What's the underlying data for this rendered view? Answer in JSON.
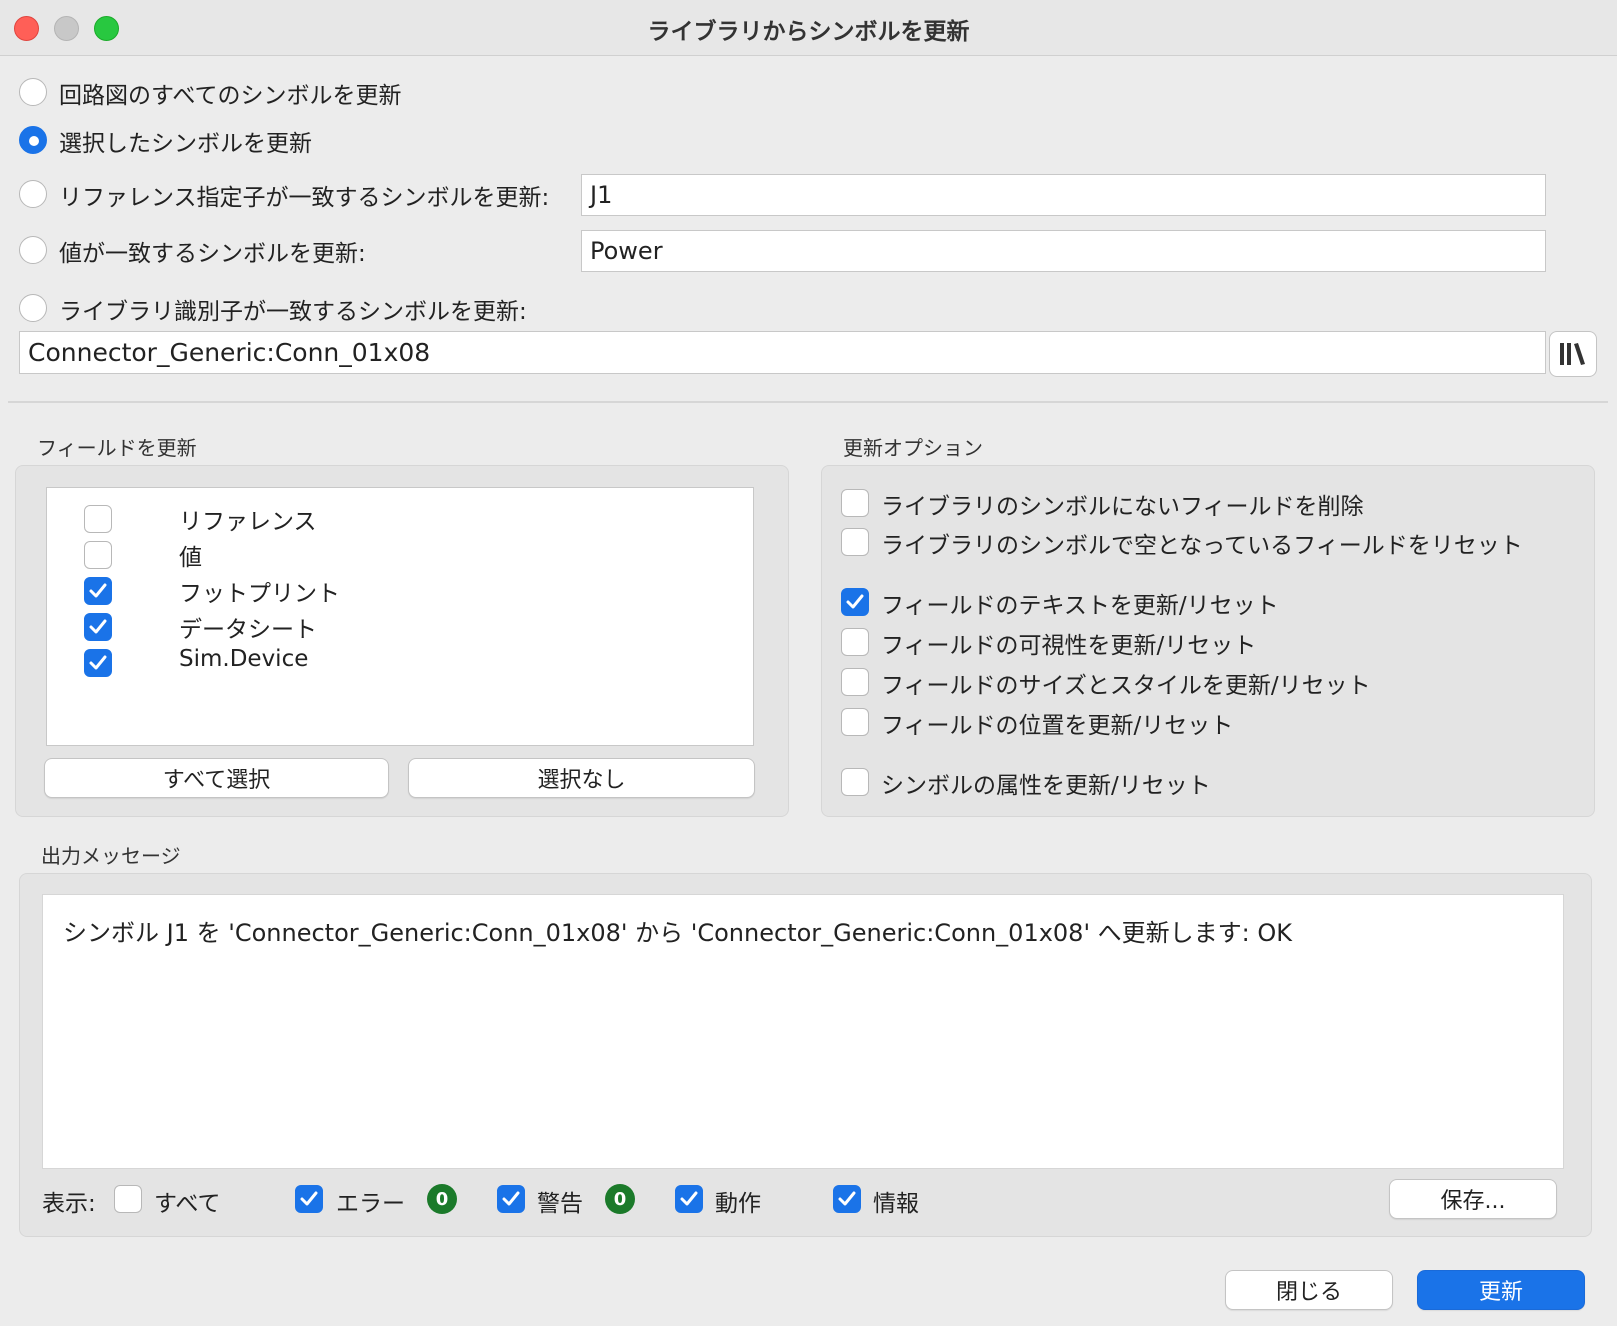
{
  "window": {
    "title": "ライブラリからシンボルを更新"
  },
  "scope": {
    "options": [
      {
        "label": "回路図のすべてのシンボルを更新",
        "selected": false
      },
      {
        "label": "選択したシンボルを更新",
        "selected": true
      },
      {
        "label": "リファレンス指定子が一致するシンボルを更新:",
        "selected": false
      },
      {
        "label": "値が一致するシンボルを更新:",
        "selected": false
      },
      {
        "label": "ライブラリ識別子が一致するシンボルを更新:",
        "selected": false
      }
    ],
    "reference_value": "J1",
    "value_value": "Power",
    "lib_id_value": "Connector_Generic:Conn_01x08"
  },
  "fields_group": {
    "title": "フィールドを更新",
    "items": [
      {
        "label": "リファレンス",
        "checked": false
      },
      {
        "label": "値",
        "checked": false
      },
      {
        "label": "フットプリント",
        "checked": true
      },
      {
        "label": "データシート",
        "checked": true
      },
      {
        "label": "Sim.Device",
        "checked": true
      }
    ],
    "select_all_label": "すべて選択",
    "select_none_label": "選択なし"
  },
  "update_options": {
    "title": "更新オプション",
    "items": [
      {
        "label": "ライブラリのシンボルにないフィールドを削除",
        "checked": false
      },
      {
        "label": "ライブラリのシンボルで空となっているフィールドをリセット",
        "checked": false
      },
      {
        "label": "フィールドのテキストを更新/リセット",
        "checked": true
      },
      {
        "label": "フィールドの可視性を更新/リセット",
        "checked": false
      },
      {
        "label": "フィールドのサイズとスタイルを更新/リセット",
        "checked": false
      },
      {
        "label": "フィールドの位置を更新/リセット",
        "checked": false
      },
      {
        "label": "シンボルの属性を更新/リセット",
        "checked": false
      }
    ]
  },
  "output": {
    "title": "出力メッセージ",
    "message": "シンボル J1 を 'Connector_Generic:Conn_01x08' から 'Connector_Generic:Conn_01x08' へ更新します: OK",
    "show_label": "表示:",
    "filters": {
      "all": {
        "label": "すべて",
        "checked": false
      },
      "errors": {
        "label": "エラー",
        "checked": true,
        "count": "0"
      },
      "warnings": {
        "label": "警告",
        "checked": true,
        "count": "0"
      },
      "actions": {
        "label": "動作",
        "checked": true
      },
      "infos": {
        "label": "情報",
        "checked": true
      }
    },
    "save_label": "保存..."
  },
  "footer": {
    "close_label": "閉じる",
    "update_label": "更新"
  },
  "colors": {
    "accent": "#1a73e8",
    "badge_green": "#1b7a2a"
  },
  "icons": {
    "library_browser": "library-books-icon"
  }
}
